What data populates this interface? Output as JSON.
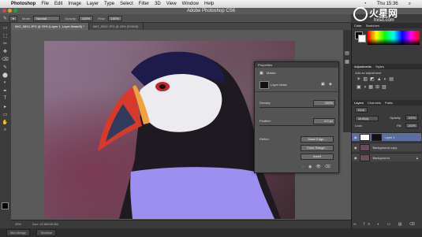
{
  "menubar": {
    "app": "Photoshop",
    "items": [
      "File",
      "Edit",
      "Image",
      "Layer",
      "Type",
      "Select",
      "Filter",
      "3D",
      "View",
      "Window",
      "Help"
    ],
    "time": "Thu 15:36"
  },
  "window_title": "Adobe Photoshop CS6",
  "options": {
    "mode_label": "Mode:",
    "mode_value": "Normal",
    "opacity_label": "Opacity:",
    "opacity_value": "100%",
    "flow_label": "Flow:",
    "flow_value": "100%"
  },
  "tabs": [
    {
      "label": "IMG_5854.JPG @ 25% (Layer 1, Layer Mask/8) *",
      "active": true
    },
    {
      "label": "IMG_5552.JPG @ 25% (RGB/8)",
      "active": false
    }
  ],
  "tools": [
    "▭",
    "⬚",
    "✂",
    "✥",
    "⌫",
    "✎",
    "⬤",
    "◐",
    "✒",
    "T",
    "▸",
    "▭",
    "✋",
    "⌕"
  ],
  "status": {
    "zoom": "25%",
    "doc": "Doc: 22.8M/35.0M"
  },
  "bottom_tabs": [
    "Mini Bridge",
    "Timeline"
  ],
  "properties": {
    "title": "Properties",
    "section": "Masks",
    "mask_label": "Layer Mask",
    "density_label": "Density:",
    "density_value": "100%",
    "feather_label": "Feather:",
    "feather_value": "0.0 px",
    "refine_label": "Refine:",
    "mask_edge_btn": "Mask Edge...",
    "color_range_btn": "Color Range...",
    "invert_btn": "Invert"
  },
  "panels": {
    "color_tabs": [
      "Color",
      "Swatches"
    ],
    "adjust_tabs": [
      "Adjustments",
      "Styles"
    ],
    "adjust_title": "Add an adjustment",
    "layer_tabs": [
      "Layers",
      "Channels",
      "Paths"
    ],
    "kind_label": "Kind",
    "blend": "Multiply",
    "opacity_label": "Opacity:",
    "opacity_value": "100%",
    "lock_label": "Lock:",
    "fill_label": "Fill:",
    "fill_value": "100%",
    "layers": [
      {
        "name": "Layer 1",
        "selected": true
      },
      {
        "name": "Background copy",
        "selected": false
      },
      {
        "name": "Background",
        "selected": false
      }
    ]
  },
  "watermark": {
    "brand": "火星网",
    "url": "hxsd.com"
  },
  "colors": {
    "mask_fill": "#9d8ff0",
    "accent": "#5a6fa0"
  }
}
